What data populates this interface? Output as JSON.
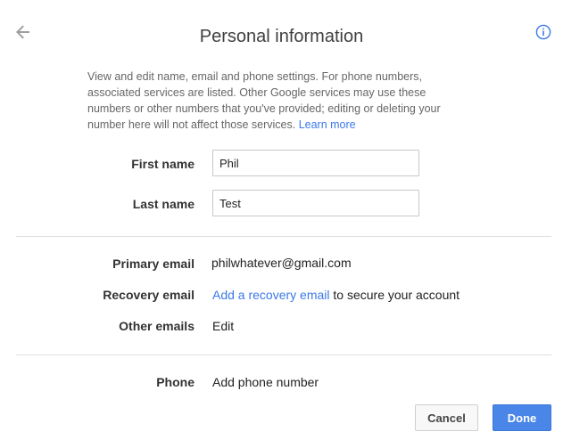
{
  "header": {
    "title": "Personal information",
    "back_icon": "arrow-left-icon",
    "info_icon": "info-icon"
  },
  "description": {
    "text": "View and edit name, email and phone settings. For phone numbers, associated services are listed. Other Google services may use these numbers or other numbers that you've provided; editing or deleting your number here will not affect those services.",
    "learn_more": "Learn more"
  },
  "name": {
    "first_label": "First name",
    "first_value": "Phil",
    "last_label": "Last name",
    "last_value": "Test"
  },
  "email": {
    "primary_label": "Primary email",
    "primary_value": "philwhatever@gmail.com",
    "recovery_label": "Recovery email",
    "recovery_link": "Add a recovery email",
    "recovery_suffix": " to secure your account",
    "other_label": "Other emails",
    "other_link": "Edit"
  },
  "phone": {
    "label": "Phone",
    "link": "Add phone number"
  },
  "actions": {
    "cancel": "Cancel",
    "done": "Done"
  },
  "colors": {
    "link": "#3b78e7",
    "primary_button": "#4a86e8"
  }
}
